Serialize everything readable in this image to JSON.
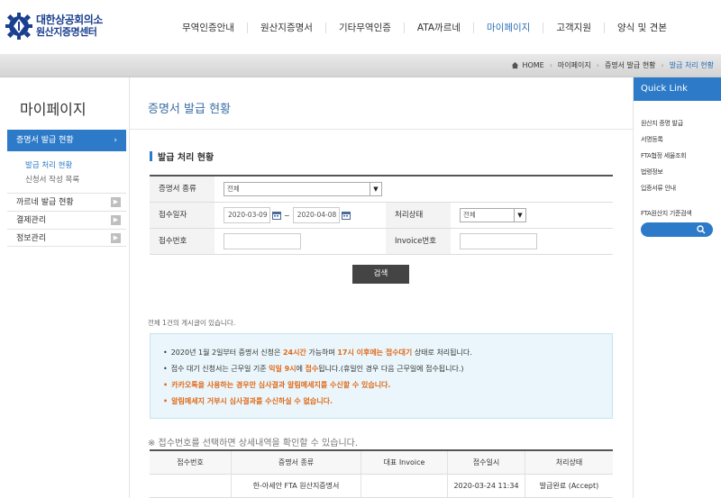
{
  "header": {
    "logo_line1": "대한상공회의소",
    "logo_line2": "원산지증명센터",
    "gnb": [
      "무역인증안내",
      "원산지증명서",
      "기타무역인증",
      "ATA까르네",
      "마이페이지",
      "고객지원",
      "양식 및 견본"
    ],
    "gnb_active_index": 4
  },
  "breadcrumb": {
    "home": "HOME",
    "items": [
      "마이페이지",
      "증명서 발급 현황"
    ],
    "current": "발급 처리 현황"
  },
  "lnb": {
    "title": "마이페이지",
    "active": "증명서 발급 현황",
    "active_arrow": "›",
    "sub": [
      "발급 처리 현황",
      "신청서 작성 목록"
    ],
    "items": [
      "까르네 발급 현황",
      "결제관리",
      "정보관리"
    ]
  },
  "main": {
    "page_title": "증명서 발급 현황",
    "section_title": "발급 처리 현황",
    "form": {
      "cert_type_label": "증명서 종류",
      "cert_type_value": "전체",
      "date_label": "접수일자",
      "date_from": "2020-03-09",
      "date_to": "2020-04-08",
      "tilde": "~",
      "status_label": "처리상태",
      "status_value": "전체",
      "receipt_label": "접수번호",
      "invoice_label": "Invoice번호"
    },
    "search_button": "검색",
    "total_text": "전체 1건의 게시글이 있습니다.",
    "notice": {
      "line1_a": "2020년 1월 2일부터 증명서 신청은 ",
      "line1_b": "24시간",
      "line1_c": " 가능하며 ",
      "line1_d": "17시 이후에는 접수대기",
      "line1_e": " 상태로 처리됩니다.",
      "line2_a": "접수 대기 신청서는 근무일 기준 ",
      "line2_b": "익일 9시",
      "line2_c": "에 ",
      "line2_d": "접수",
      "line2_e": "됩니다.(휴일인 경우 다음 근무일에 접수됩니다.)",
      "line3": "카카오톡을 사용하는 경우만 심사결과 알림메세지를 수신할 수 있습니다.",
      "line4": "알림메세지 거부시 심사결과를 수신하실 수 없습니다.",
      "bullet": "•"
    },
    "hint": "※ 접수번호를 선택하면 상세내역을 확인할 수 있습니다.",
    "table": {
      "headers": [
        "접수번호",
        "증명서 종류",
        "대표 Invoice",
        "접수일시",
        "처리상태"
      ],
      "rows": [
        [
          "",
          "한-아세안 FTA 원산지증명서",
          "",
          "2020-03-24 11:34",
          "발급완료 (Accept)"
        ]
      ]
    }
  },
  "quick": {
    "title": "Quick Link",
    "items": [
      "원산지 증명 발급",
      "서명등록",
      "FTA협정 세율조회",
      "법령정보",
      "입증서류 안내"
    ],
    "fta_label": "FTA원산지 기준검색"
  },
  "colors": {
    "accent": "#2d7bc8",
    "brand": "#1a3f8f",
    "notice_highlight": "#e06a1a"
  }
}
